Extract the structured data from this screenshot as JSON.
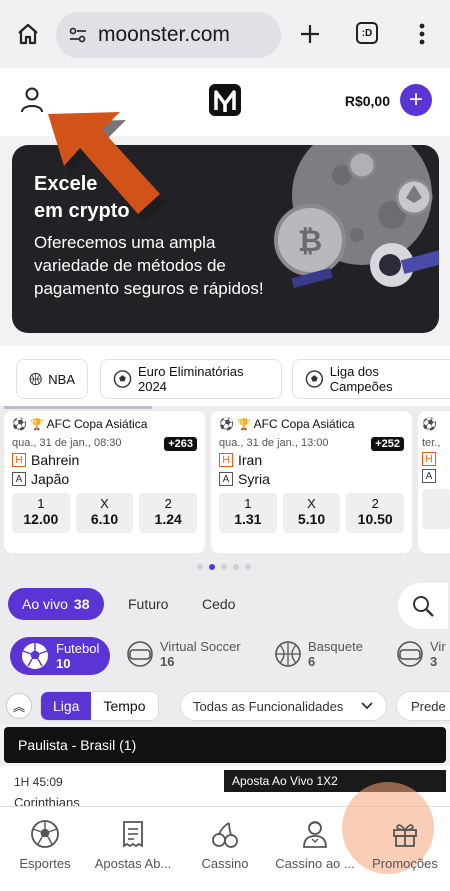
{
  "browser": {
    "url": "moonster.com",
    "tab_count": ":D"
  },
  "header": {
    "balance": "R$0,00"
  },
  "banner": {
    "title": "Excelente em crypto",
    "title_visible": "Excele... em crypto",
    "description": "Oferecemos uma ampla variedade de métodos de pagamento seguros e rápidos!"
  },
  "categories": [
    {
      "label": "NBA",
      "icon": "basketball-icon"
    },
    {
      "label": "Euro Eliminatórias 2024",
      "icon": "soccer-ball-icon"
    },
    {
      "label": "Liga dos Campeões",
      "icon": "soccer-ball-icon"
    }
  ],
  "matches": [
    {
      "league": "AFC Copa Asiática",
      "date": "qua., 31 de jan., 08:30",
      "markets": "+263",
      "home": "Bahrein",
      "away": "Japão",
      "odds": [
        {
          "label": "1",
          "value": "12.00"
        },
        {
          "label": "X",
          "value": "6.10"
        },
        {
          "label": "2",
          "value": "1.24"
        }
      ]
    },
    {
      "league": "AFC Copa Asiática",
      "date": "qua., 31 de jan., 13:00",
      "markets": "+252",
      "home": "Iran",
      "away": "Syria",
      "odds": [
        {
          "label": "1",
          "value": "1.31"
        },
        {
          "label": "X",
          "value": "5.10"
        },
        {
          "label": "2",
          "value": "10.50"
        }
      ]
    },
    {
      "date": "ter.,"
    }
  ],
  "live_tabs": {
    "active_label": "Ao vivo",
    "active_count": "38",
    "future": "Futuro",
    "early": "Cedo"
  },
  "sports": [
    {
      "name": "Futebol",
      "count": "10",
      "icon": "soccer-ball-icon"
    },
    {
      "name": "Virtual Soccer",
      "count": "16",
      "icon": "vr-headset-icon"
    },
    {
      "name": "Basquete",
      "count": "6",
      "icon": "basketball-icon"
    },
    {
      "name": "Vir",
      "count": "3",
      "icon": "vr-headset-icon"
    }
  ],
  "filters": {
    "league": "Liga",
    "time": "Tempo",
    "features": "Todas as Funcionalidades",
    "predefined": "Prede"
  },
  "region": "Paulista - Brasil (1)",
  "live_match": {
    "time": "1H  45:09",
    "team": "Corinthians",
    "tooltip": "Aposta Ao Vivo 1X2"
  },
  "bottom_nav": [
    {
      "label": "Esportes",
      "icon": "soccer-ball-icon"
    },
    {
      "label": "Apostas Ab...",
      "icon": "receipt-icon"
    },
    {
      "label": "Cassino",
      "icon": "cherries-icon"
    },
    {
      "label": "Cassino ao ...",
      "icon": "dealer-icon"
    },
    {
      "label": "Promoções",
      "icon": "gift-icon"
    }
  ],
  "colors": {
    "accent": "#5b34d6",
    "arrow": "#d2531a",
    "banner_bg": "#222226"
  }
}
